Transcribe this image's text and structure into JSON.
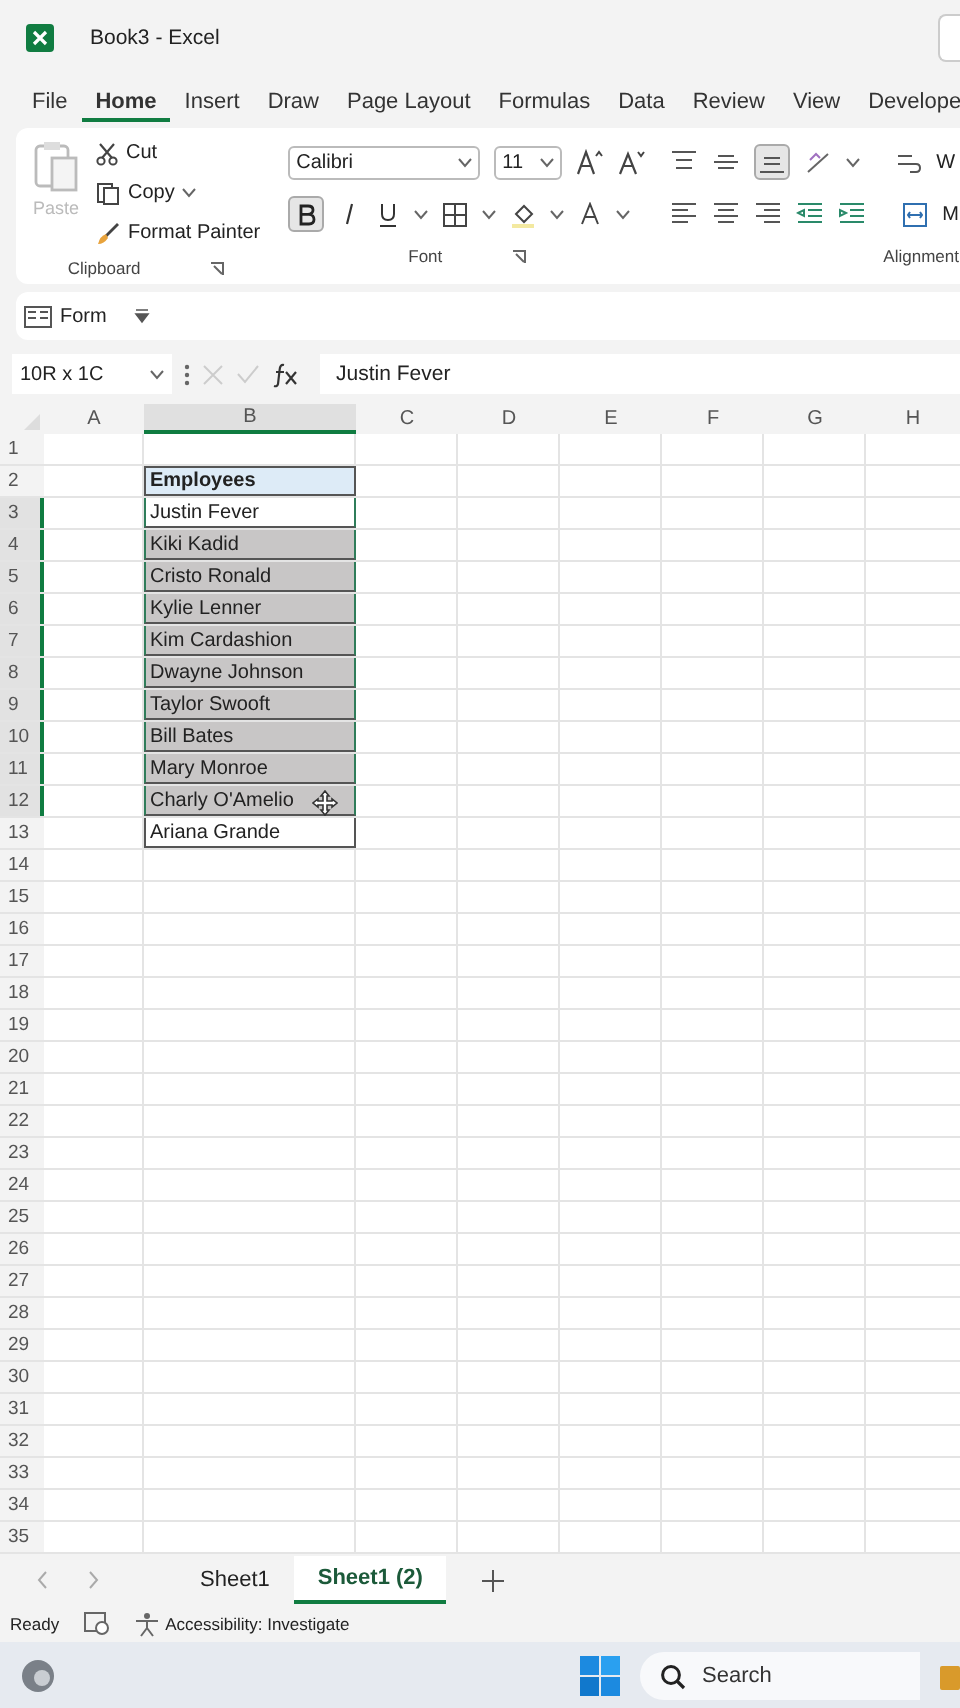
{
  "window": {
    "title": "Book3  -  Excel"
  },
  "menu_tabs": [
    {
      "label": "File",
      "selected": false
    },
    {
      "label": "Home",
      "selected": true
    },
    {
      "label": "Insert",
      "selected": false
    },
    {
      "label": "Draw",
      "selected": false
    },
    {
      "label": "Page Layout",
      "selected": false
    },
    {
      "label": "Formulas",
      "selected": false
    },
    {
      "label": "Data",
      "selected": false
    },
    {
      "label": "Review",
      "selected": false
    },
    {
      "label": "View",
      "selected": false
    },
    {
      "label": "Develope",
      "selected": false
    }
  ],
  "clipboard": {
    "paste": "Paste",
    "cut": "Cut",
    "copy": "Copy",
    "format_painter": "Format Painter",
    "group": "Clipboard"
  },
  "font": {
    "name": "Calibri",
    "size": "11",
    "bold": true,
    "group": "Font"
  },
  "alignment": {
    "bottom_align": true,
    "wrap": "W",
    "merge": "M",
    "group": "Alignment"
  },
  "form_bar": {
    "label": "Form"
  },
  "formula_bar": {
    "name_box": "10R x 1C",
    "formula": "Justin Fever"
  },
  "columns": [
    {
      "label": "A",
      "selected": false
    },
    {
      "label": "B",
      "selected": true
    },
    {
      "label": "C",
      "selected": false
    },
    {
      "label": "D",
      "selected": false
    },
    {
      "label": "E",
      "selected": false
    },
    {
      "label": "F",
      "selected": false
    },
    {
      "label": "G",
      "selected": false
    },
    {
      "label": "H",
      "selected": false
    }
  ],
  "rows": [
    {
      "number": "1",
      "selected": false
    },
    {
      "number": "2",
      "selected": false,
      "b": "Employees",
      "header": true
    },
    {
      "number": "3",
      "selected": true,
      "b": "Justin Fever",
      "active": true
    },
    {
      "number": "4",
      "selected": true,
      "b": "Kiki Kadid"
    },
    {
      "number": "5",
      "selected": true,
      "b": "Cristo Ronald"
    },
    {
      "number": "6",
      "selected": true,
      "b": "Kylie Lenner"
    },
    {
      "number": "7",
      "selected": true,
      "b": "Kim Cardashion"
    },
    {
      "number": "8",
      "selected": true,
      "b": "Dwayne Johnson"
    },
    {
      "number": "9",
      "selected": true,
      "b": "Taylor Swooft"
    },
    {
      "number": "10",
      "selected": true,
      "b": "Bill Bates"
    },
    {
      "number": "11",
      "selected": true,
      "b": "Mary Monroe"
    },
    {
      "number": "12",
      "selected": true,
      "b": "Charly O'Amelio"
    },
    {
      "number": "13",
      "selected": false,
      "b": "Ariana Grande"
    },
    {
      "number": "14",
      "selected": false
    },
    {
      "number": "15",
      "selected": false
    },
    {
      "number": "16",
      "selected": false
    },
    {
      "number": "17",
      "selected": false
    },
    {
      "number": "18",
      "selected": false
    },
    {
      "number": "19",
      "selected": false
    },
    {
      "number": "20",
      "selected": false
    },
    {
      "number": "21",
      "selected": false
    },
    {
      "number": "22",
      "selected": false
    },
    {
      "number": "23",
      "selected": false
    },
    {
      "number": "24",
      "selected": false
    },
    {
      "number": "25",
      "selected": false
    },
    {
      "number": "26",
      "selected": false
    },
    {
      "number": "27",
      "selected": false
    },
    {
      "number": "28",
      "selected": false
    },
    {
      "number": "29",
      "selected": false
    },
    {
      "number": "30",
      "selected": false
    },
    {
      "number": "31",
      "selected": false
    },
    {
      "number": "32",
      "selected": false
    },
    {
      "number": "33",
      "selected": false
    },
    {
      "number": "34",
      "selected": false
    },
    {
      "number": "35",
      "selected": false
    }
  ],
  "sheet_tabs": [
    {
      "label": "Sheet1",
      "selected": false
    },
    {
      "label": "Sheet1 (2)",
      "selected": true
    }
  ],
  "status_bar": {
    "ready": "Ready",
    "accessibility": "Accessibility: Investigate"
  },
  "taskbar": {
    "search_placeholder": "Search"
  }
}
